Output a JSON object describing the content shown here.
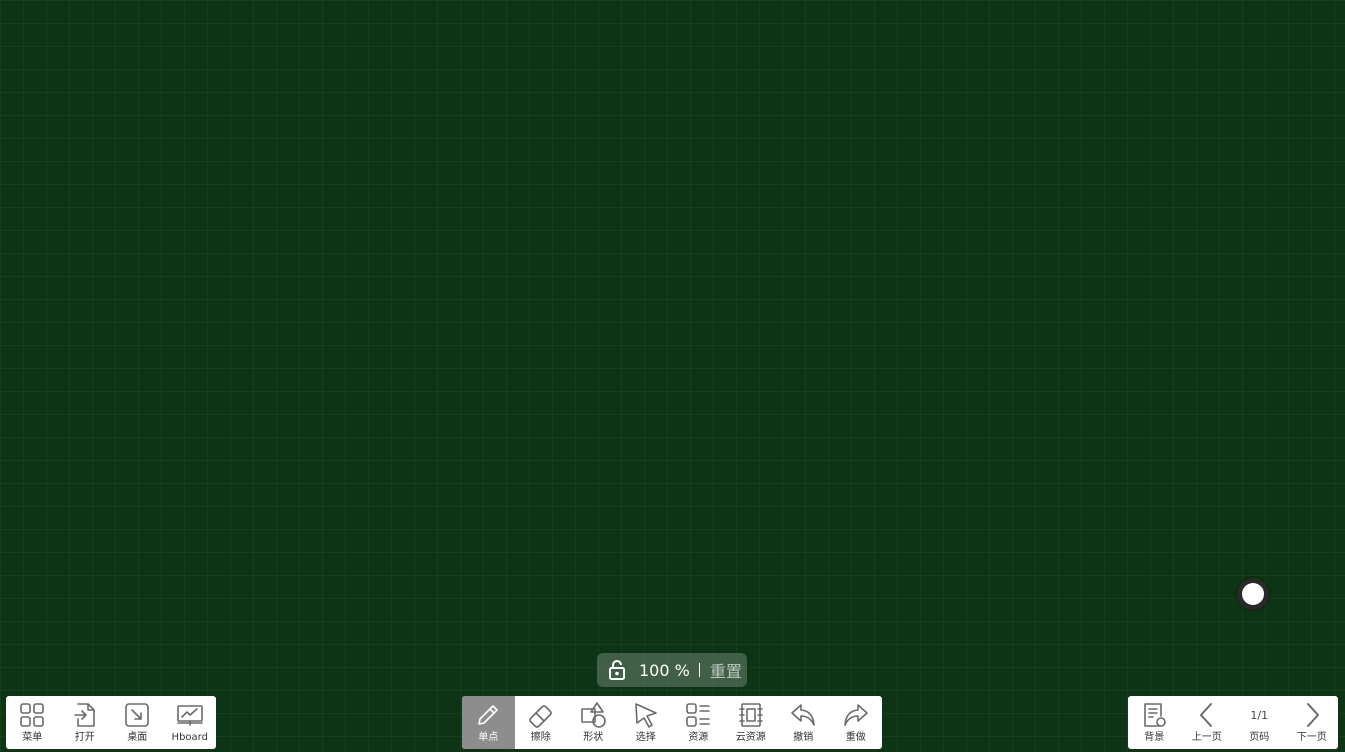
{
  "zoom": {
    "percent": "100 %",
    "reset_label": "重置"
  },
  "left_toolbar": {
    "items": [
      {
        "label": "菜单",
        "icon": "grid-icon"
      },
      {
        "label": "打开",
        "icon": "open-file-icon"
      },
      {
        "label": "桌面",
        "icon": "desktop-icon"
      },
      {
        "label": "Hboard",
        "icon": "hboard-icon"
      }
    ]
  },
  "center_toolbar": {
    "items": [
      {
        "label": "单点",
        "icon": "pen-icon",
        "active": true
      },
      {
        "label": "擦除",
        "icon": "eraser-icon"
      },
      {
        "label": "形状",
        "icon": "shapes-icon"
      },
      {
        "label": "选择",
        "icon": "select-cursor-icon"
      },
      {
        "label": "资源",
        "icon": "resource-list-icon"
      },
      {
        "label": "云资源",
        "icon": "cloud-resource-icon"
      },
      {
        "label": "撤销",
        "icon": "undo-icon"
      },
      {
        "label": "重做",
        "icon": "redo-icon"
      }
    ]
  },
  "right_toolbar": {
    "items": [
      {
        "label": "背景",
        "icon": "background-icon"
      },
      {
        "label": "上一页",
        "icon": "chevron-left-icon"
      },
      {
        "label": "页码",
        "value": "1/1"
      },
      {
        "label": "下一页",
        "icon": "chevron-right-icon"
      }
    ]
  },
  "colors": {
    "board_background": "#0d3414",
    "toolbar_background": "#ffffff",
    "active_tool": "#8d8d8d"
  }
}
